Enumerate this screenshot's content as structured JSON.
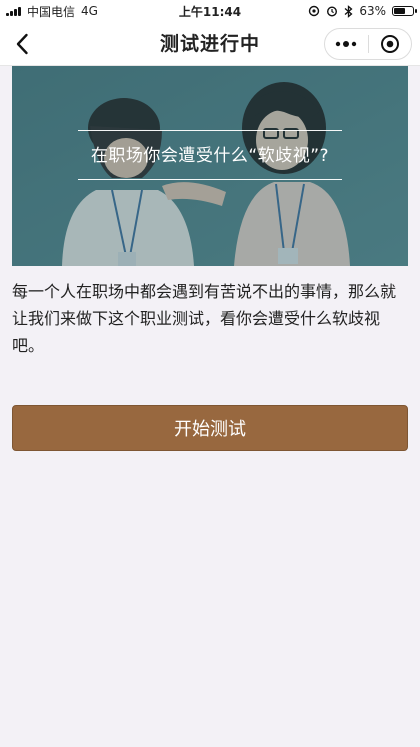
{
  "status_bar": {
    "carrier": "中国电信",
    "network": "4G",
    "time": "上午11:44",
    "battery": {
      "percent_text": "63%",
      "level": 0.63
    }
  },
  "nav": {
    "title": "测试进行中"
  },
  "hero": {
    "title": "在职场你会遭受什么“软歧视”?"
  },
  "intro": {
    "text": "每一个人在职场中都会遇到有苦说不出的事情，那么就让我们来做下这个职业测试，看你会遭受什么软歧视吧。"
  },
  "actions": {
    "start_label": "开始测试"
  },
  "colors": {
    "accent": "#98683f",
    "page_background": "#f3f1f6",
    "hero_background": "#4f7f86"
  },
  "icons": {
    "back": "chevron-left-icon",
    "more": "more-dots-icon",
    "close": "target-close-icon"
  }
}
